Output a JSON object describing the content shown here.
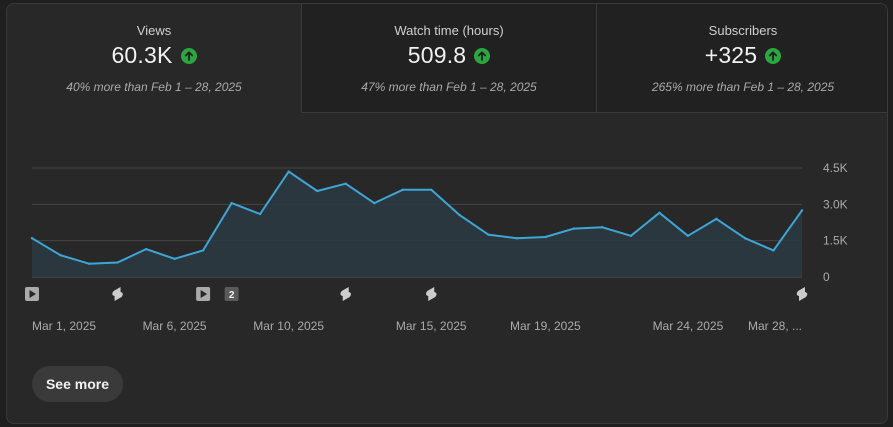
{
  "metrics": [
    {
      "label": "Views",
      "value": "60.3K",
      "compare": "40% more than Feb 1 – 28, 2025",
      "trend": "up"
    },
    {
      "label": "Watch time (hours)",
      "value": "509.8",
      "compare": "47% more than Feb 1 – 28, 2025",
      "trend": "up"
    },
    {
      "label": "Subscribers",
      "value": "+325",
      "compare": "265% more than Feb 1 – 28, 2025",
      "trend": "up"
    }
  ],
  "see_more_label": "See more",
  "colors": {
    "line": "#3ea6d6",
    "up": "#2ba640",
    "grid": "#444444"
  },
  "chart_data": {
    "type": "area",
    "x": [
      "Mar 1",
      "Mar 2",
      "Mar 3",
      "Mar 4",
      "Mar 5",
      "Mar 6",
      "Mar 7",
      "Mar 8",
      "Mar 9",
      "Mar 10",
      "Mar 11",
      "Mar 12",
      "Mar 13",
      "Mar 14",
      "Mar 15",
      "Mar 16",
      "Mar 17",
      "Mar 18",
      "Mar 19",
      "Mar 20",
      "Mar 21",
      "Mar 22",
      "Mar 23",
      "Mar 24",
      "Mar 25",
      "Mar 26",
      "Mar 27",
      "Mar 28"
    ],
    "series": [
      {
        "values": [
          1600,
          900,
          550,
          600,
          1150,
          750,
          1100,
          3050,
          2600,
          4350,
          3550,
          3850,
          3050,
          3600,
          3600,
          2550,
          1750,
          1600,
          1650,
          2000,
          2050,
          1700,
          2650,
          1700,
          2400,
          1600,
          1100,
          2750
        ]
      }
    ],
    "ylim": [
      0,
      4500
    ],
    "yticks": [
      {
        "v": 0,
        "label": "0"
      },
      {
        "v": 1500,
        "label": "1.5K"
      },
      {
        "v": 3000,
        "label": "3.0K"
      },
      {
        "v": 4500,
        "label": "4.5K"
      }
    ],
    "xticks": [
      {
        "i": 0,
        "label": "Mar 1, 2025"
      },
      {
        "i": 5,
        "label": "Mar 6, 2025"
      },
      {
        "i": 9,
        "label": "Mar 10, 2025"
      },
      {
        "i": 14,
        "label": "Mar 15, 2025"
      },
      {
        "i": 18,
        "label": "Mar 19, 2025"
      },
      {
        "i": 23,
        "label": "Mar 24, 2025"
      },
      {
        "i": 27,
        "label": "Mar 28, ..."
      }
    ],
    "markers": [
      {
        "i": 0,
        "kind": "video"
      },
      {
        "i": 3,
        "kind": "short"
      },
      {
        "i": 6,
        "kind": "video"
      },
      {
        "i": 7,
        "kind": "count",
        "label": "2"
      },
      {
        "i": 11,
        "kind": "short"
      },
      {
        "i": 14,
        "kind": "short"
      },
      {
        "i": 27,
        "kind": "short"
      }
    ],
    "grid": true
  }
}
